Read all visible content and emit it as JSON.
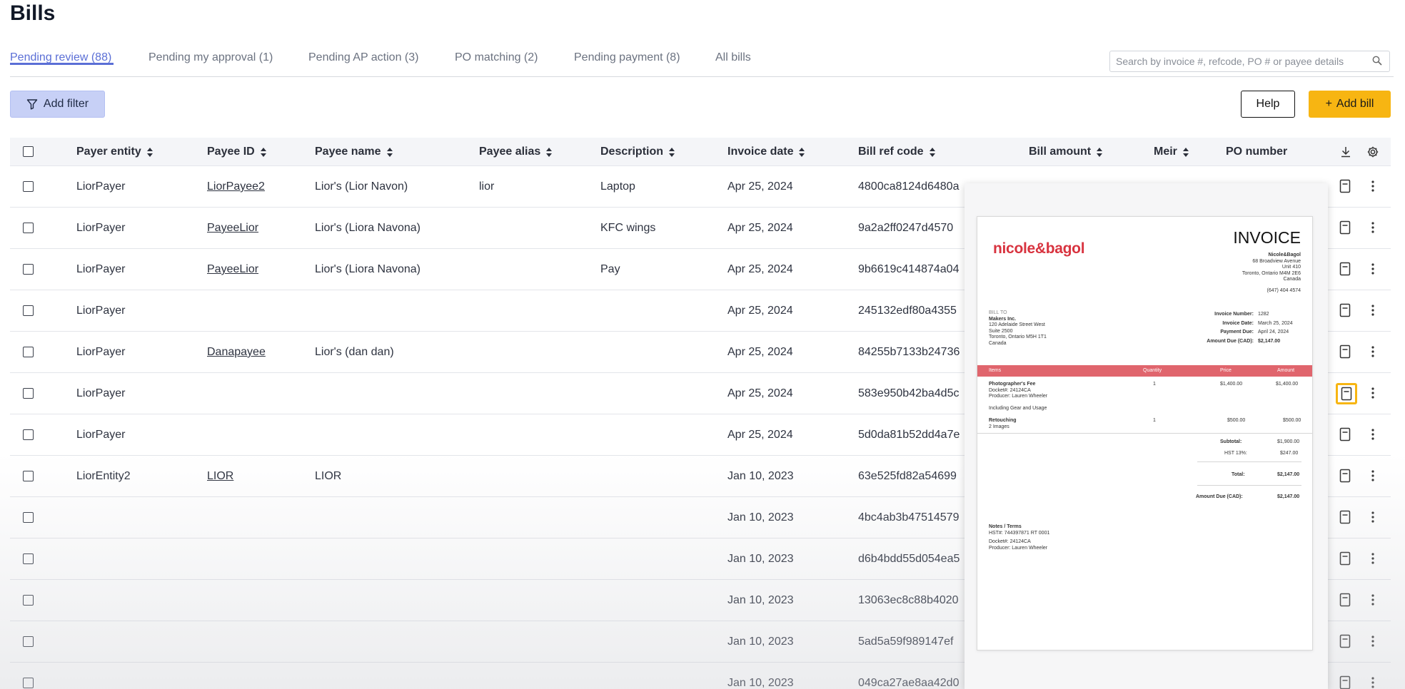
{
  "page": {
    "title": "Bills"
  },
  "tabs": [
    {
      "label": "Pending review (88)",
      "active": true
    },
    {
      "label": "Pending my approval (1)"
    },
    {
      "label": "Pending AP action (3)"
    },
    {
      "label": "PO matching (2)"
    },
    {
      "label": "Pending payment (8)"
    },
    {
      "label": "All bills"
    }
  ],
  "search": {
    "placeholder": "Search by invoice #, refcode, PO # or payee details",
    "value": ""
  },
  "toolbar": {
    "add_filter_label": "Add filter",
    "help_label": "Help",
    "add_bill_label": "Add bill",
    "add_bill_prefix": "+"
  },
  "colors": {
    "accent": "#5b6fd6",
    "primary_button": "#f7b512",
    "filter_button": "#c7d0f6",
    "brand_red": "#d8333f"
  },
  "table": {
    "columns": [
      "Payer entity",
      "Payee ID",
      "Payee name",
      "Payee alias",
      "Description",
      "Invoice date",
      "Bill ref code",
      "Bill amount",
      "Meir",
      "PO number"
    ],
    "rows": [
      {
        "payer": "LiorPayer",
        "payee_id": "LiorPayee2",
        "payee_name": "Lior's (Lior Navon)",
        "alias": "lior",
        "desc": "Laptop",
        "date": "Apr 25, 2024",
        "ref": "4800ca8124d6480a"
      },
      {
        "payer": "LiorPayer",
        "payee_id": "PayeeLior",
        "payee_name": "Lior's (Liora Navona)",
        "alias": "",
        "desc": "KFC wings",
        "date": "Apr 25, 2024",
        "ref": "9a2a2ff0247d4570"
      },
      {
        "payer": "LiorPayer",
        "payee_id": "PayeeLior",
        "payee_name": "Lior's (Liora Navona)",
        "alias": "",
        "desc": "Pay",
        "date": "Apr 25, 2024",
        "ref": "9b6619c414874a04"
      },
      {
        "payer": "LiorPayer",
        "payee_id": "",
        "payee_name": "",
        "alias": "",
        "desc": "",
        "date": "Apr 25, 2024",
        "ref": "245132edf80a4355"
      },
      {
        "payer": "LiorPayer",
        "payee_id": "Danapayee",
        "payee_name": "Lior's (dan dan)",
        "alias": "",
        "desc": "",
        "date": "Apr 25, 2024",
        "ref": "84255b7133b24736"
      },
      {
        "payer": "LiorPayer",
        "payee_id": "",
        "payee_name": "",
        "alias": "",
        "desc": "",
        "date": "Apr 25, 2024",
        "ref": "583e950b42ba4d5c"
      },
      {
        "payer": "LiorPayer",
        "payee_id": "",
        "payee_name": "",
        "alias": "",
        "desc": "",
        "date": "Apr 25, 2024",
        "ref": "5d0da81b52dd4a7e"
      },
      {
        "payer": "LiorEntity2",
        "payee_id": "LIOR",
        "payee_name": "LIOR",
        "alias": "",
        "desc": "",
        "date": "Jan 10, 2023",
        "ref": "63e525fd82a54699"
      },
      {
        "payer": "",
        "payee_id": "",
        "payee_name": "",
        "alias": "",
        "desc": "",
        "date": "Jan 10, 2023",
        "ref": "4bc4ab3b47514579"
      },
      {
        "payer": "",
        "payee_id": "",
        "payee_name": "",
        "alias": "",
        "desc": "",
        "date": "Jan 10, 2023",
        "ref": "d6b4bdd55d054ea5"
      },
      {
        "payer": "",
        "payee_id": "",
        "payee_name": "",
        "alias": "",
        "desc": "",
        "date": "Jan 10, 2023",
        "ref": "13063ec8c88b4020"
      },
      {
        "payer": "",
        "payee_id": "",
        "payee_name": "",
        "alias": "",
        "desc": "",
        "date": "Jan 10, 2023",
        "ref": "5ad5a59f989147ef"
      },
      {
        "payer": "",
        "payee_id": "",
        "payee_name": "",
        "alias": "",
        "desc": "",
        "date": "Jan 10, 2023",
        "ref": "049ca27ae8aa42d0"
      }
    ]
  },
  "invoice_preview": {
    "brand": "nicole&bagol",
    "title": "INVOICE",
    "sender": [
      "Nicole&Bagol",
      "68 Broadview Avenue",
      "Unit 410",
      "Toronto, Ontario M4M 2E6",
      "Canada"
    ],
    "phone": "(647) 404 4574",
    "bill_to": [
      "BILL TO",
      "Makers Inc.",
      "120 Adelaide Street West",
      "Suite 2500",
      "Toronto, Ontario M5H 1T1",
      "Canada"
    ],
    "meta": [
      {
        "label": "Invoice Number:",
        "value": "1282"
      },
      {
        "label": "Invoice Date:",
        "value": "March 25, 2024"
      },
      {
        "label": "Payment Due:",
        "value": "April 24, 2024"
      },
      {
        "label": "Amount Due (CAD):",
        "value": "$2,147.00"
      }
    ],
    "headers": {
      "items": "Items",
      "quantity": "Quantity",
      "price": "Price",
      "amount": "Amount"
    },
    "items": [
      {
        "name": "Photographer's Fee",
        "detail": "Docket#: 24124CA",
        "detail2": "Producer: Lauren Wheeler",
        "extra": "Including Gear and Usage",
        "qty": "1",
        "price": "$1,400.00",
        "amount": "$1,400.00"
      },
      {
        "name": "Retouching",
        "detail": "2 Images",
        "qty": "1",
        "price": "$500.00",
        "amount": "$500.00"
      }
    ],
    "totals": [
      {
        "label": "Subtotal:",
        "value": "$1,900.00"
      },
      {
        "label": "HST 13%:",
        "value": "$247.00"
      },
      {
        "label": "Total:",
        "value": "$2,147.00"
      },
      {
        "label": "Amount Due (CAD):",
        "value": "$2,147.00"
      }
    ],
    "notes": [
      "Notes / Terms",
      "HST#: 744397871 RT 0001",
      "Docket#: 24124CA",
      "Producer: Lauren Wheeler"
    ]
  }
}
